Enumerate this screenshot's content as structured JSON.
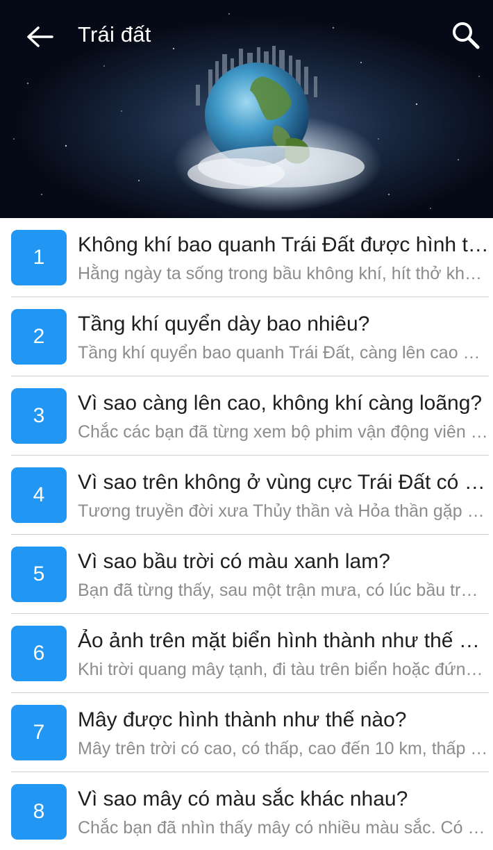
{
  "app": {
    "title": "Trái đất",
    "back_icon": "arrow-left-icon",
    "search_icon": "search-icon",
    "header_image": "earth-globe-cityscape-banner"
  },
  "colors": {
    "badge": "#2196f3",
    "title_text": "#1e1e1e",
    "subtitle_text": "#8c8c8c",
    "divider": "#cfcfcf"
  },
  "items": [
    {
      "number": "1",
      "title": "Không khí bao quanh Trái Đất được hình thành như thế nào?",
      "subtitle": "Hằng ngày ta sống trong bầu không khí, hít thở không khí"
    },
    {
      "number": "2",
      "title": "Tầng khí quyển dày bao nhiêu?",
      "subtitle": "Tầng khí quyển bao quanh Trái Đất, càng lên cao càng loãng"
    },
    {
      "number": "3",
      "title": "Vì sao càng lên cao, không khí càng loãng?",
      "subtitle": "Chắc các bạn đã từng xem bộ phim vận động viên leo núi"
    },
    {
      "number": "4",
      "title": "Vì sao trên không ở vùng cực Trái Đất có lúc xuất hiện cực quang?",
      "subtitle": "Tương truyền đời xưa Thủy thần và Hỏa thần gặp nhau"
    },
    {
      "number": "5",
      "title": "Vì sao bầu trời có màu xanh lam?",
      "subtitle": "Bạn đã từng thấy, sau một trận mưa, có lúc bầu trời trong xanh"
    },
    {
      "number": "6",
      "title": "Ảo ảnh trên mặt biển hình thành như thế nào?",
      "subtitle": "Khi trời quang mây tạnh, đi tàu trên biển hoặc đứng trên bờ"
    },
    {
      "number": "7",
      "title": "Mây được hình thành như thế nào?",
      "subtitle": "Mây trên trời có cao, có thấp, cao đến 10 km, thấp chỉ vài trăm mét"
    },
    {
      "number": "8",
      "title": "Vì sao mây có màu sắc khác nhau?",
      "subtitle": "Chắc bạn đã nhìn thấy mây có nhiều màu sắc. Có mây trắng"
    }
  ]
}
